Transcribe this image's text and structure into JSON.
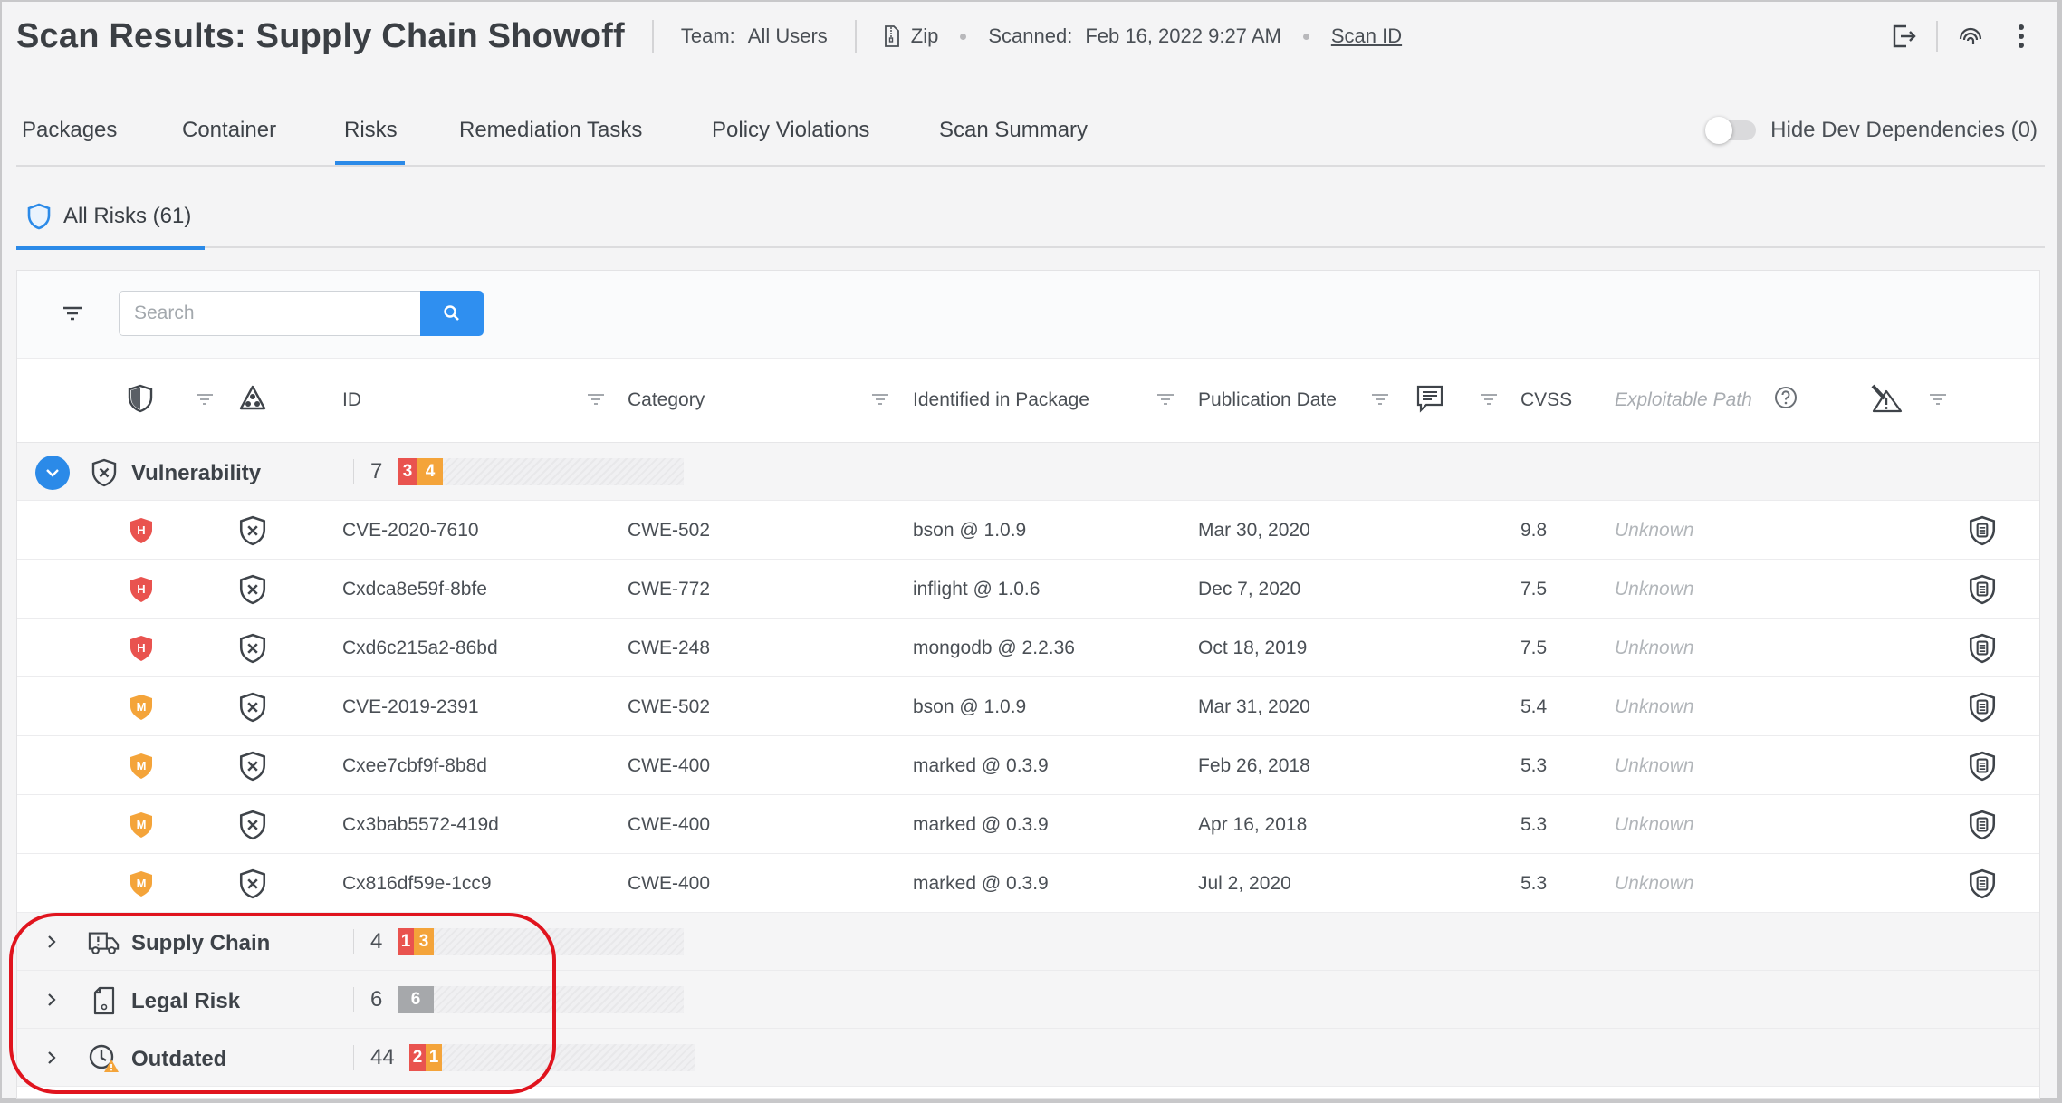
{
  "header": {
    "title": "Scan Results: Supply Chain Showoff",
    "team_label": "Team:",
    "team_value": "All Users",
    "source_type": "Zip",
    "scanned_label": "Scanned:",
    "scanned_value": "Feb 16, 2022 9:27 AM",
    "scan_id_link": "Scan ID",
    "icons": [
      "export-icon",
      "fingerprint-icon",
      "more-vertical-icon"
    ]
  },
  "tabs": [
    {
      "label": "Packages",
      "active": false
    },
    {
      "label": "Container",
      "active": false
    },
    {
      "label": "Risks",
      "active": true
    },
    {
      "label": "Remediation Tasks",
      "active": false
    },
    {
      "label": "Policy Violations",
      "active": false
    },
    {
      "label": "Scan Summary",
      "active": false
    }
  ],
  "toggle": {
    "label": "Hide Dev Dependencies (0)",
    "checked": false
  },
  "subtab": {
    "label": "All Risks (61)",
    "icon": "shield-icon"
  },
  "search": {
    "placeholder": "Search",
    "value": ""
  },
  "columns": {
    "id": "ID",
    "category": "Category",
    "package": "Identified in Package",
    "publication_date": "Publication Date",
    "cvss": "CVSS",
    "exploitable_path": "Exploitable Path"
  },
  "colors": {
    "accent": "#2b8ae8",
    "high": "#e9534f",
    "medium": "#f4a43a",
    "neutral": "#a6a8ab",
    "annotation": "#e0141e"
  },
  "groups": [
    {
      "name": "Vulnerability",
      "icon": "shield-x-icon",
      "expanded": true,
      "count": "7",
      "high": "3",
      "medium": "4"
    },
    {
      "name": "Supply Chain",
      "icon": "truck-icon",
      "expanded": false,
      "count": "4",
      "high": "1",
      "medium": "3"
    },
    {
      "name": "Legal Risk",
      "icon": "document-icon",
      "expanded": false,
      "count": "6",
      "neutral": "6"
    },
    {
      "name": "Outdated",
      "icon": "clock-warning-icon",
      "expanded": false,
      "count": "44",
      "high": "2",
      "medium": "1"
    }
  ],
  "vulnerabilities": [
    {
      "severity": "H",
      "id": "CVE-2020-7610",
      "category": "CWE-502",
      "package": "bson @ 1.0.9",
      "date": "Mar 30, 2020",
      "cvss": "9.8",
      "path": "Unknown"
    },
    {
      "severity": "H",
      "id": "Cxdca8e59f-8bfe",
      "category": "CWE-772",
      "package": "inflight @ 1.0.6",
      "date": "Dec 7, 2020",
      "cvss": "7.5",
      "path": "Unknown"
    },
    {
      "severity": "H",
      "id": "Cxd6c215a2-86bd",
      "category": "CWE-248",
      "package": "mongodb @ 2.2.36",
      "date": "Oct 18, 2019",
      "cvss": "7.5",
      "path": "Unknown"
    },
    {
      "severity": "M",
      "id": "CVE-2019-2391",
      "category": "CWE-502",
      "package": "bson @ 1.0.9",
      "date": "Mar 31, 2020",
      "cvss": "5.4",
      "path": "Unknown"
    },
    {
      "severity": "M",
      "id": "Cxee7cbf9f-8b8d",
      "category": "CWE-400",
      "package": "marked @ 0.3.9",
      "date": "Feb 26, 2018",
      "cvss": "5.3",
      "path": "Unknown"
    },
    {
      "severity": "M",
      "id": "Cx3bab5572-419d",
      "category": "CWE-400",
      "package": "marked @ 0.3.9",
      "date": "Apr 16, 2018",
      "cvss": "5.3",
      "path": "Unknown"
    },
    {
      "severity": "M",
      "id": "Cx816df59e-1cc9",
      "category": "CWE-400",
      "package": "marked @ 0.3.9",
      "date": "Jul 2, 2020",
      "cvss": "5.3",
      "path": "Unknown"
    }
  ]
}
